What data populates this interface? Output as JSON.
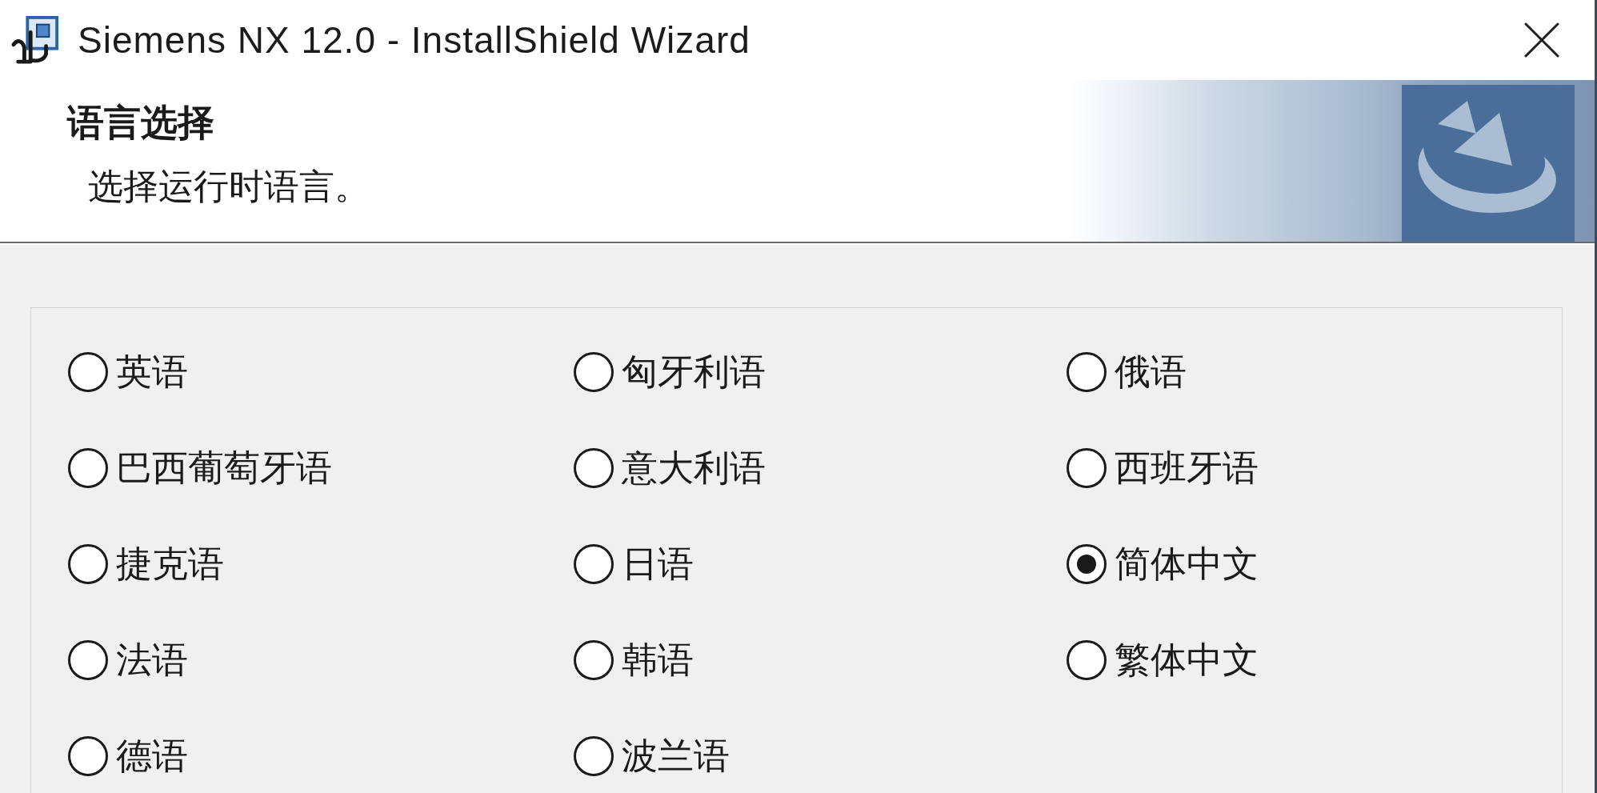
{
  "window": {
    "title": "Siemens NX 12.0 - InstallShield Wizard"
  },
  "header": {
    "title": "语言选择",
    "subtitle": "选择运行时语言。"
  },
  "languages": [
    {
      "label": "英语",
      "selected": false
    },
    {
      "label": "巴西葡萄牙语",
      "selected": false
    },
    {
      "label": "捷克语",
      "selected": false
    },
    {
      "label": "法语",
      "selected": false
    },
    {
      "label": "德语",
      "selected": false
    },
    {
      "label": "匈牙利语",
      "selected": false
    },
    {
      "label": "意大利语",
      "selected": false
    },
    {
      "label": "日语",
      "selected": false
    },
    {
      "label": "韩语",
      "selected": false
    },
    {
      "label": "波兰语",
      "selected": false
    },
    {
      "label": "俄语",
      "selected": false
    },
    {
      "label": "西班牙语",
      "selected": false
    },
    {
      "label": "简体中文",
      "selected": true
    },
    {
      "label": "繁体中文",
      "selected": false
    }
  ]
}
